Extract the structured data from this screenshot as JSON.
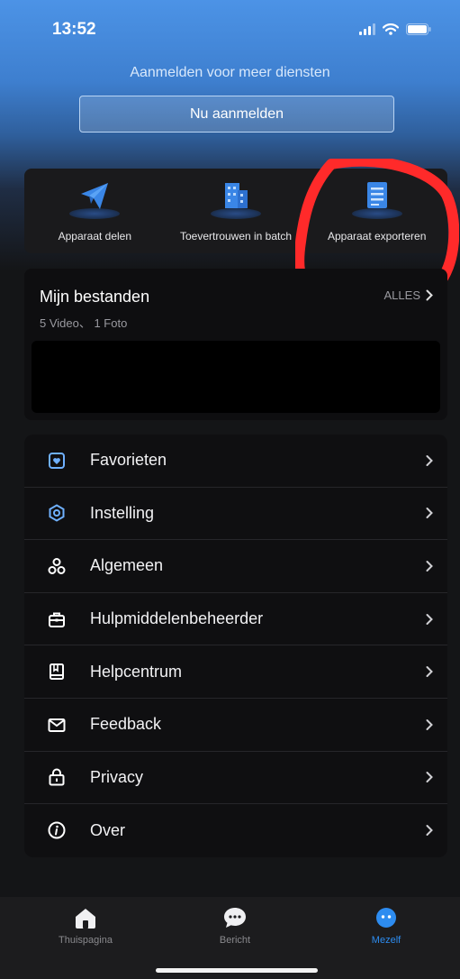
{
  "status_bar": {
    "time": "13:52"
  },
  "login": {
    "title": "Aanmelden voor meer diensten",
    "button_label": "Nu aanmelden"
  },
  "quick_actions": [
    {
      "label": "Apparaat delen",
      "icon": "paper-plane-icon"
    },
    {
      "label": "Toevertrouwen in batch",
      "icon": "building-icon"
    },
    {
      "label": "Apparaat exporteren",
      "icon": "document-icon"
    }
  ],
  "files": {
    "title": "Mijn bestanden",
    "subtitle": "5 Video、 1 Foto",
    "all_label": "ALLES"
  },
  "menu": [
    {
      "label": "Favorieten",
      "icon": "favorites-icon"
    },
    {
      "label": "Instelling",
      "icon": "settings-icon"
    },
    {
      "label": "Algemeen",
      "icon": "general-icon"
    },
    {
      "label": "Hulpmiddelenbeheerder",
      "icon": "toolbox-icon"
    },
    {
      "label": "Helpcentrum",
      "icon": "book-icon"
    },
    {
      "label": "Feedback",
      "icon": "mail-icon"
    },
    {
      "label": "Privacy",
      "icon": "lock-icon"
    },
    {
      "label": "Over",
      "icon": "info-icon"
    }
  ],
  "tabs": [
    {
      "label": "Thuispagina",
      "icon": "home-icon",
      "active": false
    },
    {
      "label": "Bericht",
      "icon": "message-icon",
      "active": false
    },
    {
      "label": "Mezelf",
      "icon": "profile-icon",
      "active": true
    }
  ],
  "colors": {
    "accent": "#2d8cf0",
    "highlight_mark": "#ff2a2a",
    "header_gradient_top": "#4c93e6",
    "background": "#141517"
  }
}
